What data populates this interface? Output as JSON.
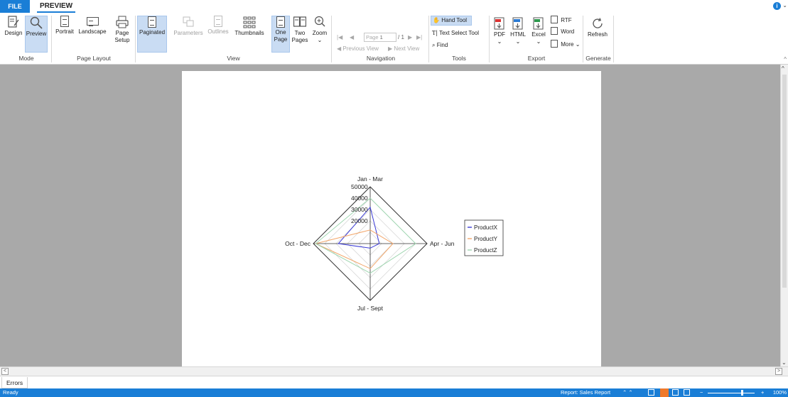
{
  "tabs": {
    "file": "FILE",
    "preview": "PREVIEW"
  },
  "ribbon": {
    "mode": {
      "label": "Mode",
      "design": "Design",
      "preview": "Preview"
    },
    "page_layout": {
      "label": "Page Layout",
      "portrait": "Portrait",
      "landscape": "Landscape",
      "page_setup": [
        "Page",
        "Setup"
      ]
    },
    "view": {
      "label": "View",
      "paginated": "Paginated",
      "parameters": "Parameters",
      "outlines": "Outlines",
      "thumbnails": "Thumbnails",
      "one_page": [
        "One",
        "Page"
      ],
      "two_pages": [
        "Two",
        "Pages"
      ],
      "zoom": "Zoom"
    },
    "navigation": {
      "label": "Navigation",
      "page_placeholder": "Page",
      "page_value": "1",
      "page_total": "/ 1",
      "previous_view": "Previous View",
      "next_view": "Next View"
    },
    "tools": {
      "label": "Tools",
      "hand_tool": "Hand Tool",
      "text_select_tool": "Text Select Tool",
      "find": "Find"
    },
    "export": {
      "label": "Export",
      "pdf": "PDF",
      "html": "HTML",
      "excel": "Excel",
      "rtf": "RTF",
      "word": "Word",
      "more": "More"
    },
    "generate": {
      "label": "Generate",
      "refresh": "Refresh"
    }
  },
  "chart_data": {
    "type": "radar",
    "categories": [
      "Jan - Mar",
      "Apr - Jun",
      "Jul - Sept",
      "Oct - Dec"
    ],
    "tick_labels": [
      "20000",
      "30000",
      "40000",
      "50000"
    ],
    "rlim": [
      0,
      50000
    ],
    "series": [
      {
        "name": "ProductX",
        "color": "#3a3ad6",
        "values": [
          32000,
          8000,
          4000,
          28000
        ]
      },
      {
        "name": "ProductY",
        "color": "#f2a66a",
        "values": [
          12000,
          20000,
          22000,
          48000
        ]
      },
      {
        "name": "ProductZ",
        "color": "#9fd6b0",
        "values": [
          40000,
          40000,
          26000,
          48000
        ]
      }
    ],
    "legend_position": "right",
    "grid": true
  },
  "errors_tab": "Errors",
  "status": {
    "left": "Ready",
    "report": "Report: Sales Report",
    "zoom": "100%"
  },
  "colors": {
    "accent": "#1a7ed6",
    "selected": "#c9dcf3"
  }
}
